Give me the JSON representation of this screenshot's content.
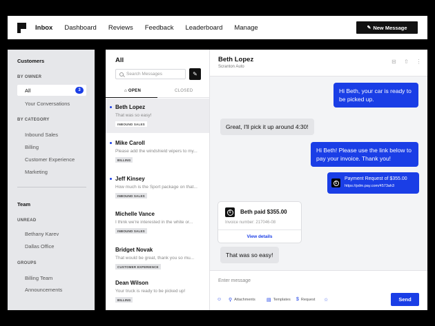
{
  "nav": {
    "items": [
      "Inbox",
      "Dashboard",
      "Reviews",
      "Feedback",
      "Leaderboard",
      "Manage"
    ],
    "new_message": "New Message"
  },
  "sidebar": {
    "title": "Customers",
    "by_owner": "BY OWNER",
    "all": "All",
    "all_count": "3",
    "your_conversations": "Your Conversations",
    "by_category": "BY CATEGORY",
    "categories": [
      "Inbound Sales",
      "Billing",
      "Customer Experience",
      "Marketing"
    ],
    "team_title": "Team",
    "unread": "UNREAD",
    "unread_items": [
      "Bethany Karev",
      "Dallas Office"
    ],
    "groups": "GROUPS",
    "group_items": [
      "Billing Team",
      "Announcements"
    ]
  },
  "list": {
    "title": "All",
    "search_placeholder": "Search Messages",
    "tab_open": "OPEN",
    "tab_closed": "CLOSED",
    "conversations": [
      {
        "name": "Beth Lopez",
        "snippet": "That was so easy!",
        "tag": "INBOUND SALES",
        "unread": true,
        "selected": true
      },
      {
        "name": "Mike Caroll",
        "snippet": "Please add the windshield wipers to my...",
        "tag": "BILLING",
        "unread": true,
        "selected": false
      },
      {
        "name": "Jeff Kinsey",
        "snippet": "How much is the Sport package on that...",
        "tag": "INBOUND SALES",
        "unread": true,
        "selected": false
      },
      {
        "name": "Michelle Vance",
        "snippet": "I think we're interested in the white or...",
        "tag": "INBOUND SALES",
        "unread": false,
        "selected": false
      },
      {
        "name": "Bridget Novak",
        "snippet": "That would be great, thank you so mu...",
        "tag": "CUSTOMER EXPERIENCE",
        "unread": false,
        "selected": false
      },
      {
        "name": "Dean Wilson",
        "snippet": "Your truck is ready to be picked up!",
        "tag": "BILLING",
        "unread": false,
        "selected": false
      }
    ]
  },
  "chat": {
    "name": "Beth Lopez",
    "subtitle": "Scranton Auto",
    "messages": {
      "m1": "Hi Beth, your car is ready to be picked up.",
      "m2": "Great, I'll pick it up around 4:30!",
      "m3": "Hi Beth! Please use the link below to pay your invoice. Thank you!",
      "m6": "That was so easy!"
    },
    "payment": {
      "title": "Payment Request of $355.00",
      "link": "https://pdm.pay.com/4573ah3"
    },
    "paid_card": {
      "title": "Beth paid $355.00",
      "invoice": "Invoice number: 217046-08",
      "link": "View details"
    },
    "composer": {
      "placeholder": "Enter message",
      "tools": [
        "Attachments",
        "Templates",
        "Request"
      ],
      "send": "Send"
    }
  },
  "colors": {
    "accent": "#1a3ee6",
    "sidebar_bg": "#e6e7ea",
    "chat_bg": "#f3f4f6"
  }
}
